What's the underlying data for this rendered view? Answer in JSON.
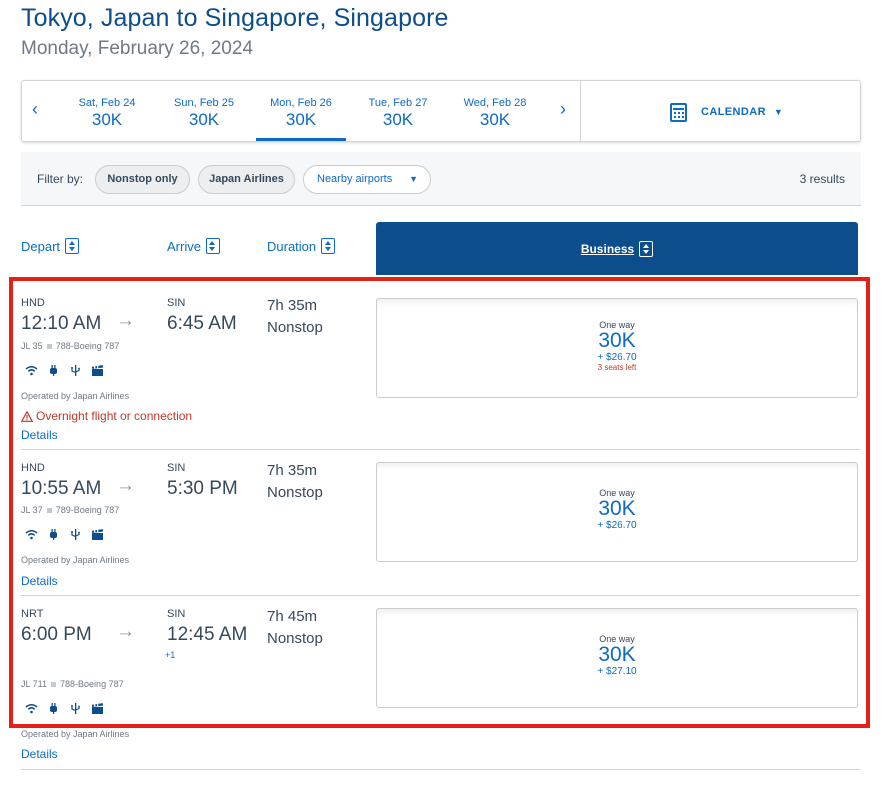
{
  "header": {
    "title": "Tokyo, Japan to Singapore, Singapore",
    "date": "Monday, February 26, 2024"
  },
  "date_bar": {
    "prev_icon": "chevron-left-icon",
    "next_icon": "chevron-right-icon",
    "dates": [
      {
        "label": "Sat, Feb 24",
        "price": "30K",
        "active": false
      },
      {
        "label": "Sun, Feb 25",
        "price": "30K",
        "active": false
      },
      {
        "label": "Mon, Feb 26",
        "price": "30K",
        "active": true
      },
      {
        "label": "Tue, Feb 27",
        "price": "30K",
        "active": false
      },
      {
        "label": "Wed, Feb 28",
        "price": "30K",
        "active": false
      }
    ],
    "calendar_label": "CALENDAR",
    "calendar_icon": "calendar-icon"
  },
  "filters": {
    "label": "Filter by:",
    "chips": [
      "Nonstop only",
      "Japan Airlines"
    ],
    "dropdown": "Nearby airports",
    "results": "3 results"
  },
  "columns": {
    "depart": "Depart",
    "arrive": "Arrive",
    "duration": "Duration",
    "cabin": "Business"
  },
  "flights": [
    {
      "from": "HND",
      "dep_time": "12:10 AM",
      "to": "SIN",
      "arr_time": "6:45 AM",
      "next_day": "",
      "duration": "7h 35m",
      "stops": "Nonstop",
      "flight_number": "JL 35",
      "aircraft": "788-Boeing 787",
      "operated_by": "Operated by Japan Airlines",
      "warning": "Overnight flight or connection",
      "details": "Details",
      "fare": {
        "label": "One way",
        "miles": "30K",
        "tax": "+ $26.70",
        "seats": "3 seats left"
      }
    },
    {
      "from": "HND",
      "dep_time": "10:55 AM",
      "to": "SIN",
      "arr_time": "5:30 PM",
      "next_day": "",
      "duration": "7h 35m",
      "stops": "Nonstop",
      "flight_number": "JL 37",
      "aircraft": "789-Boeing 787",
      "operated_by": "Operated by Japan Airlines",
      "warning": "",
      "details": "Details",
      "fare": {
        "label": "One way",
        "miles": "30K",
        "tax": "+ $26.70",
        "seats": ""
      }
    },
    {
      "from": "NRT",
      "dep_time": "6:00 PM",
      "to": "SIN",
      "arr_time": "12:45 AM",
      "next_day": "+1",
      "duration": "7h 45m",
      "stops": "Nonstop",
      "flight_number": "JL 711",
      "aircraft": "788-Boeing 787",
      "operated_by": "Operated by Japan Airlines",
      "warning": "",
      "details": "Details",
      "fare": {
        "label": "One way",
        "miles": "30K",
        "tax": "+ $27.10",
        "seats": ""
      }
    }
  ],
  "amenity_icons": [
    "wifi-icon",
    "power-outlet-icon",
    "usb-icon",
    "entertainment-icon"
  ],
  "colors": {
    "brand_blue": "#0c4d8c",
    "link_blue": "#0c6bc4",
    "warning_red": "#c0392b",
    "highlight_red": "#e32119"
  }
}
